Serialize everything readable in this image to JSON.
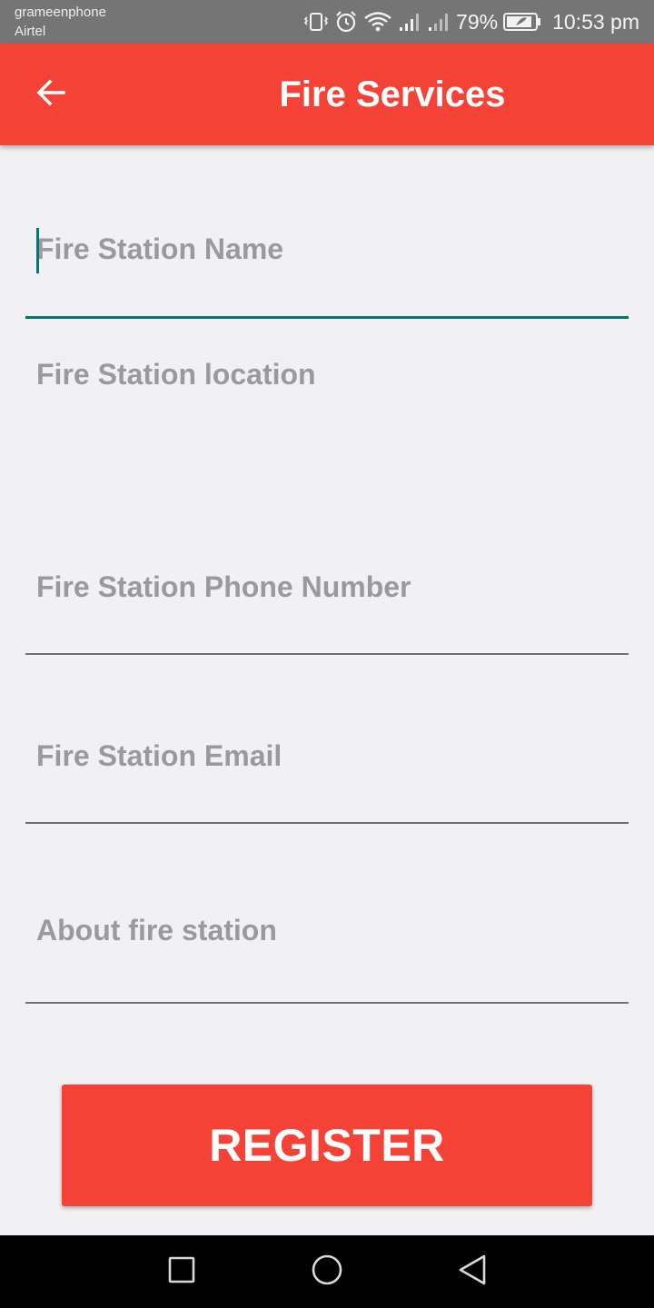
{
  "status_bar": {
    "carrier_1": "grameenphone",
    "carrier_2": "Airtel",
    "battery": "79%",
    "time": "10:53 pm",
    "icons": [
      "vibrate-icon",
      "alarm-icon",
      "wifi-icon",
      "signal-icon",
      "signal-icon",
      "battery-icon"
    ]
  },
  "app_bar": {
    "title": "Fire Services",
    "back_icon": "arrow-left-icon",
    "color": "#f44336"
  },
  "form": {
    "name_placeholder": "Fire Station Name",
    "name_value": "",
    "location_placeholder": "Fire Station location",
    "location_value": "",
    "phone_placeholder": "Fire Station Phone Number",
    "phone_value": "",
    "email_placeholder": "Fire Station Email",
    "email_value": "",
    "about_placeholder": "About fire station",
    "about_value": "",
    "focus_color": "#00796b"
  },
  "register_label": "REGISTER",
  "nav_bar": {
    "icons": [
      "square-recents-icon",
      "circle-home-icon",
      "triangle-back-icon"
    ]
  }
}
